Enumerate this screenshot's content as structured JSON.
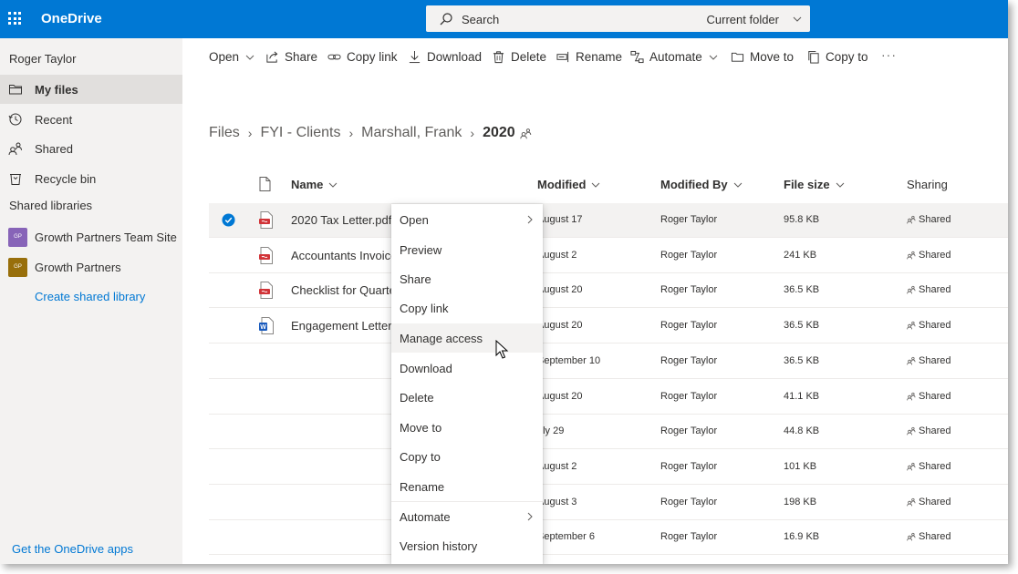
{
  "app": {
    "brand": "OneDrive",
    "search_placeholder": "Search",
    "search_scope": "Current folder"
  },
  "sidebar": {
    "user": "Roger Taylor",
    "items": [
      {
        "label": "My files",
        "icon": "folder-icon"
      },
      {
        "label": "Recent",
        "icon": "history-icon"
      },
      {
        "label": "Shared",
        "icon": "people-icon"
      },
      {
        "label": "Recycle bin",
        "icon": "recycle-bin-icon"
      }
    ],
    "section_title": "Shared libraries",
    "libraries": [
      {
        "label": "Growth Partners Team Site",
        "badge": "GP",
        "color": "#8764b8"
      },
      {
        "label": "Growth Partners",
        "badge": "GP",
        "color": "#986f0b"
      }
    ],
    "create_library": "Create shared library",
    "get_apps": "Get the OneDrive apps"
  },
  "commands": [
    {
      "label": "Open",
      "icon": "",
      "dropdown": true
    },
    {
      "label": "Share",
      "icon": "share-icon"
    },
    {
      "label": "Copy link",
      "icon": "link-icon"
    },
    {
      "label": "Download",
      "icon": "download-icon"
    },
    {
      "label": "Delete",
      "icon": "delete-icon"
    },
    {
      "label": "Rename",
      "icon": "rename-icon"
    },
    {
      "label": "Automate",
      "icon": "automate-icon",
      "dropdown": true
    },
    {
      "label": "Move to",
      "icon": "move-icon"
    },
    {
      "label": "Copy to",
      "icon": "copy-icon"
    }
  ],
  "more_label": "···",
  "breadcrumb": [
    "Files",
    "FYI - Clients",
    "Marshall, Frank",
    "2020"
  ],
  "columns": {
    "name": "Name",
    "modified": "Modified",
    "modified_by": "Modified By",
    "file_size": "File size",
    "sharing": "Sharing"
  },
  "files": [
    {
      "name": "2020 Tax Letter.pdf",
      "type": "pdf",
      "modified": "August 17",
      "modified_by": "Roger Taylor",
      "size": "95.8 KB",
      "sharing": "Shared",
      "selected": true
    },
    {
      "name": "Accountants Invoice",
      "type": "pdf",
      "modified": "August 2",
      "modified_by": "Roger Taylor",
      "size": "241 KB",
      "sharing": "Shared"
    },
    {
      "name": "Checklist for Quarter",
      "type": "pdf",
      "modified": "August 20",
      "modified_by": "Roger Taylor",
      "size": "36.5 KB",
      "sharing": "Shared"
    },
    {
      "name": "Engagement Letter.d",
      "type": "word",
      "modified": "August 20",
      "modified_by": "Roger Taylor",
      "size": "36.5 KB",
      "sharing": "Shared"
    },
    {
      "name": "",
      "type": "",
      "modified": "September 10",
      "modified_by": "Roger Taylor",
      "size": "36.5 KB",
      "sharing": "Shared"
    },
    {
      "name": "",
      "type": "",
      "modified": "August 20",
      "modified_by": "Roger Taylor",
      "size": "41.1 KB",
      "sharing": "Shared"
    },
    {
      "name": "",
      "type": "",
      "modified": "uly 29",
      "modified_by": "Roger Taylor",
      "size": "44.8 KB",
      "sharing": "Shared"
    },
    {
      "name": "",
      "type": "",
      "modified": "August 2",
      "modified_by": "Roger Taylor",
      "size": "101 KB",
      "sharing": "Shared"
    },
    {
      "name": "",
      "type": "",
      "modified": "August 3",
      "modified_by": "Roger Taylor",
      "size": "198 KB",
      "sharing": "Shared"
    },
    {
      "name": "",
      "type": "",
      "modified": "September 6",
      "modified_by": "Roger Taylor",
      "size": "16.9 KB",
      "sharing": "Shared"
    }
  ],
  "context_menu": [
    {
      "label": "Open",
      "submenu": true
    },
    {
      "label": "Preview"
    },
    {
      "label": "Share"
    },
    {
      "label": "Copy link"
    },
    {
      "label": "Manage access",
      "hover": true
    },
    {
      "label": "Download"
    },
    {
      "label": "Delete"
    },
    {
      "label": "Move to"
    },
    {
      "label": "Copy to"
    },
    {
      "label": "Rename"
    },
    {
      "label": "Automate",
      "submenu": true
    },
    {
      "label": "Version history"
    }
  ],
  "colors": {
    "brand_blue": "#0078d4",
    "nav_bg": "#f3f2f1",
    "pdf_red": "#d13438",
    "word_blue": "#185abd"
  }
}
